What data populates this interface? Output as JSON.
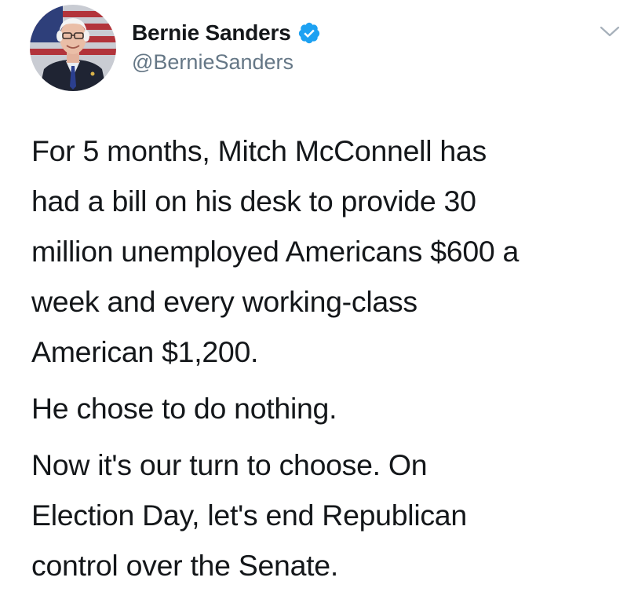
{
  "tweet": {
    "author": {
      "display_name": "Bernie Sanders",
      "handle": "@BernieSanders",
      "verified": true,
      "avatar_icon": "profile-photo"
    },
    "menu_icon": "chevron-down-icon",
    "colors": {
      "text": "#14171a",
      "secondary": "#657786",
      "verified_blue": "#1da1f2"
    },
    "paragraphs": [
      {
        "lines": [
          "For 5 months, Mitch McConnell has",
          "had a bill on his desk to provide 30",
          "million unemployed Americans $600 a",
          "week and every working-class",
          "American $1,200."
        ]
      },
      {
        "lines": [
          "He chose to do nothing."
        ]
      },
      {
        "lines": [
          "Now it's our turn to choose. On",
          "Election Day, let's end Republican",
          "control over the Senate."
        ]
      }
    ]
  }
}
